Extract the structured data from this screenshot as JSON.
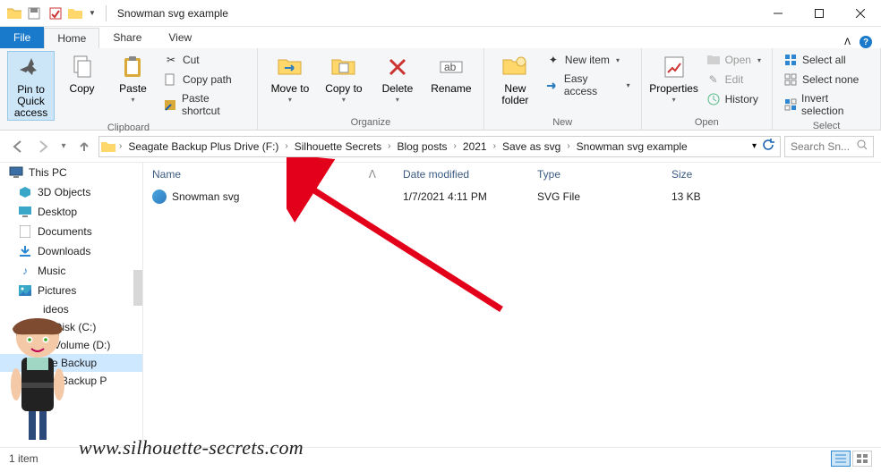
{
  "title": "Snowman svg example",
  "tabs": {
    "file": "File",
    "home": "Home",
    "share": "Share",
    "view": "View"
  },
  "ribbon": {
    "pin": "Pin to Quick access",
    "copy": "Copy",
    "paste": "Paste",
    "cut": "Cut",
    "copypath": "Copy path",
    "pasteshort": "Paste shortcut",
    "clipboard": "Clipboard",
    "moveto": "Move to",
    "copyto": "Copy to",
    "delete": "Delete",
    "rename": "Rename",
    "organize": "Organize",
    "newfolder": "New folder",
    "newitem": "New item",
    "easy": "Easy access",
    "new": "New",
    "properties": "Properties",
    "open": "Open",
    "edit": "Edit",
    "history": "History",
    "openg": "Open",
    "selall": "Select all",
    "selnone": "Select none",
    "invert": "Invert selection",
    "select": "Select"
  },
  "breadcrumbs": [
    "Seagate Backup Plus Drive (F:)",
    "Silhouette Secrets",
    "Blog posts",
    "2021",
    "Save as svg",
    "Snowman svg example"
  ],
  "search_placeholder": "Search Sn...",
  "columns": {
    "name": "Name",
    "date": "Date modified",
    "type": "Type",
    "size": "Size"
  },
  "file": {
    "name": "Snowman svg",
    "date": "1/7/2021 4:11 PM",
    "type": "SVG File",
    "size": "13 KB"
  },
  "sidebar": {
    "thispc": "This PC",
    "items": [
      "3D Objects",
      "Desktop",
      "Documents",
      "Downloads",
      "Music",
      "Pictures",
      "Videos",
      "Local Disk (C:)",
      "New Volume (D:)",
      "Seagate Backup",
      "Seagate Backup P"
    ]
  },
  "sidebar_truncated": {
    "videos": "ideos",
    "local": "al Disk (C:)",
    "newvol": "w Volume (D:)",
    "sb1": "ate Backup",
    "sb2": "ate Backup P"
  },
  "status": "1 item",
  "watermark": "www.silhouette-secrets.com"
}
